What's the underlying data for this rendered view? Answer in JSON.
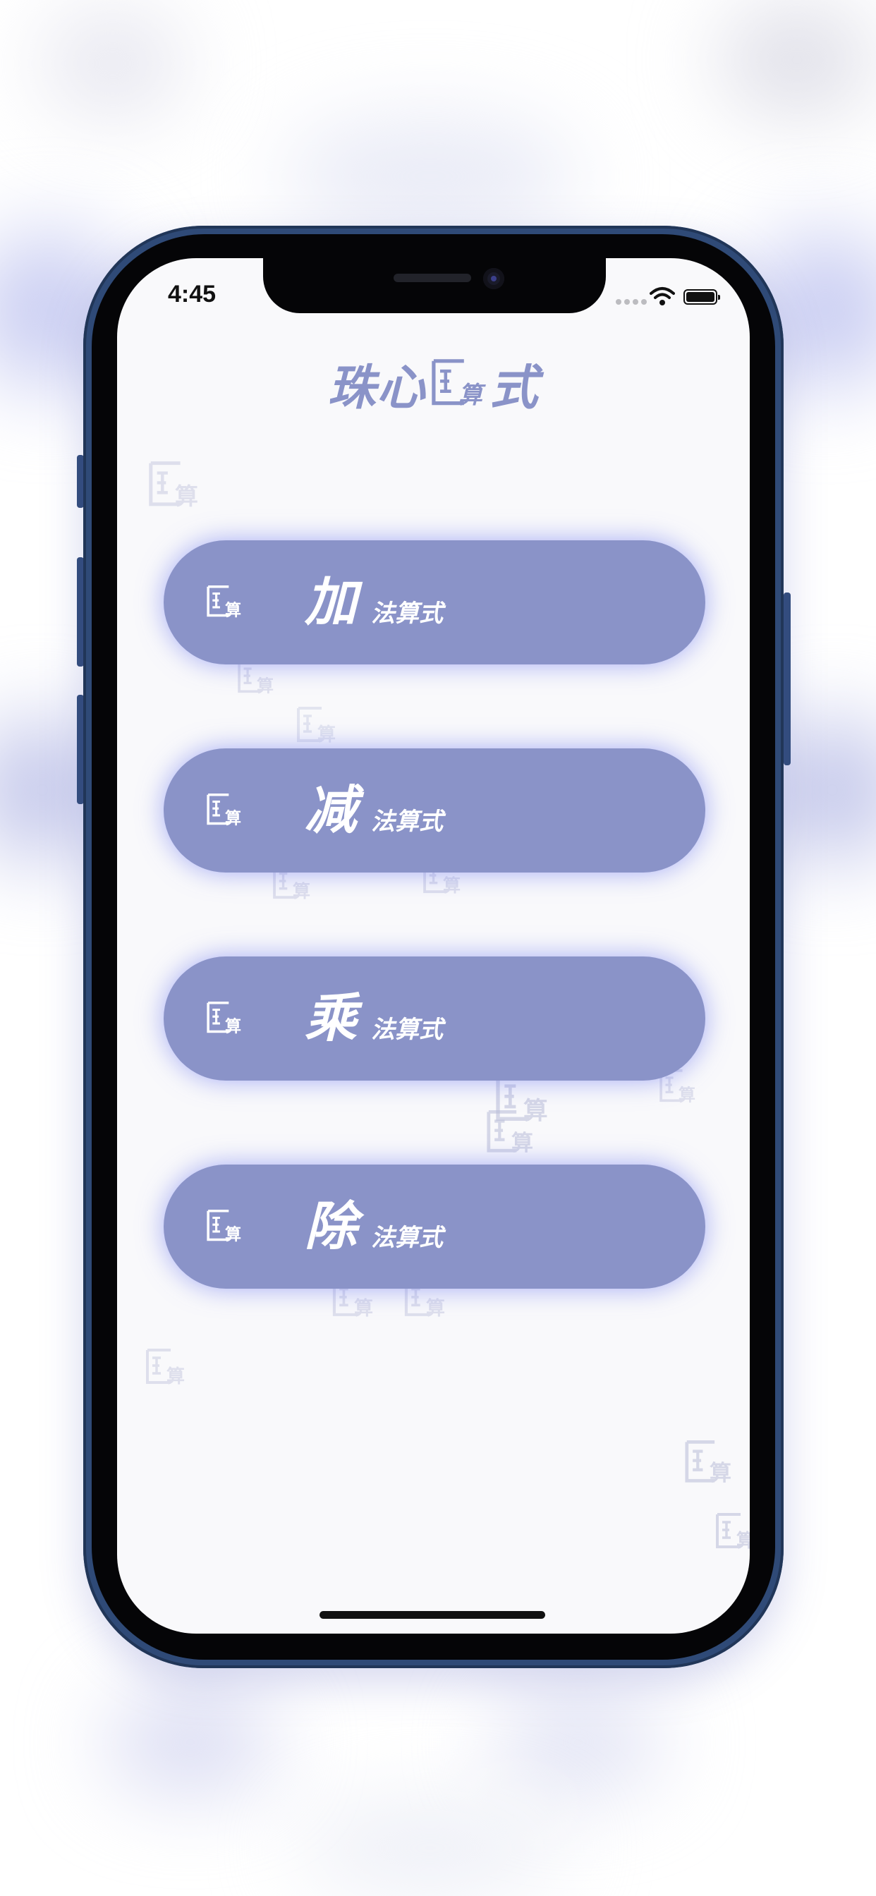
{
  "status_bar": {
    "time": "4:45"
  },
  "app": {
    "title_left": "珠心",
    "title_right": "式"
  },
  "operations": [
    {
      "char": "加",
      "suffix": "法算式"
    },
    {
      "char": "减",
      "suffix": "法算式"
    },
    {
      "char": "乘",
      "suffix": "法算式"
    },
    {
      "char": "除",
      "suffix": "法算式"
    }
  ],
  "logo": {
    "inner_char": "算"
  },
  "colors": {
    "accent": "#8a93c8",
    "screen_bg": "#f9f9fb",
    "phone_frame": "#2f4a77",
    "glow": "#6070f0"
  },
  "icons": [
    "abacus-logo-icon",
    "wifi-icon",
    "battery-icon",
    "signal-icon"
  ]
}
